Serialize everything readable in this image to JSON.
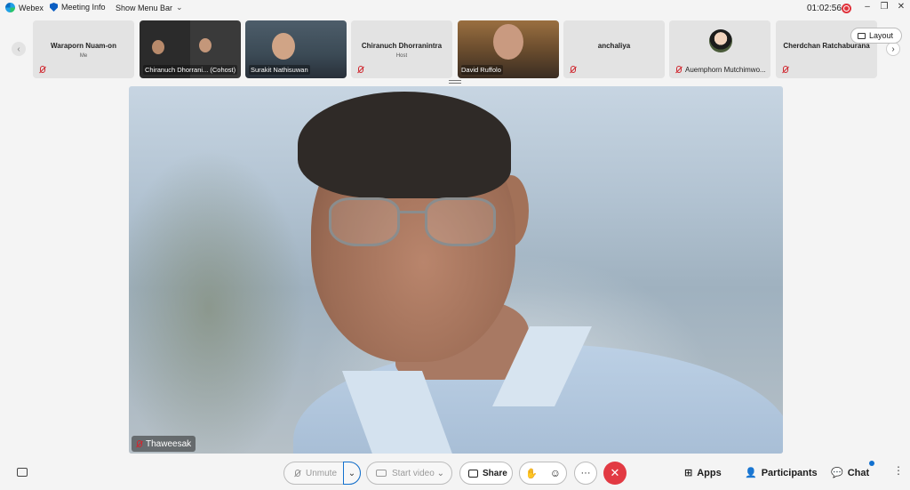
{
  "titlebar": {
    "app_name": "Webex",
    "meeting_info": "Meeting Info",
    "show_menu_bar": "Show Menu Bar",
    "timer": "01:02:56",
    "minimize": "–",
    "restore": "❐",
    "close": "✕"
  },
  "strip": {
    "prev": "‹",
    "next": "›",
    "tiles": [
      {
        "name": "Waraporn Nuam-on",
        "sub": "Me",
        "muted": true
      },
      {
        "name": "Chiranuch Dhorrani... (Cohost)",
        "video": true,
        "muted": false
      },
      {
        "name": "Surakit Nathisuwan",
        "video": true,
        "muted": false
      },
      {
        "name": "Chiranuch Dhorranintra",
        "sub": "Host",
        "muted": true
      },
      {
        "name": "David Ruffolo",
        "video": true,
        "muted": true
      },
      {
        "name": "anchaliya",
        "muted": true
      },
      {
        "name": "Auemphorn Mutchimwo...",
        "avatar": true,
        "muted": true
      },
      {
        "name": "Cherdchan Ratchaburana",
        "muted": true
      }
    ]
  },
  "layout_button": "Layout",
  "stage": {
    "speaker_name": "Thaweesak"
  },
  "controls": {
    "unmute": "Unmute",
    "start_video": "Start video",
    "share": "Share",
    "apps": "Apps",
    "participants": "Participants",
    "chat": "Chat",
    "more": "···",
    "end": "✕"
  },
  "colors": {
    "accent": "#1170cf",
    "end_call": "#e23a43",
    "muted": "#d0272f"
  }
}
